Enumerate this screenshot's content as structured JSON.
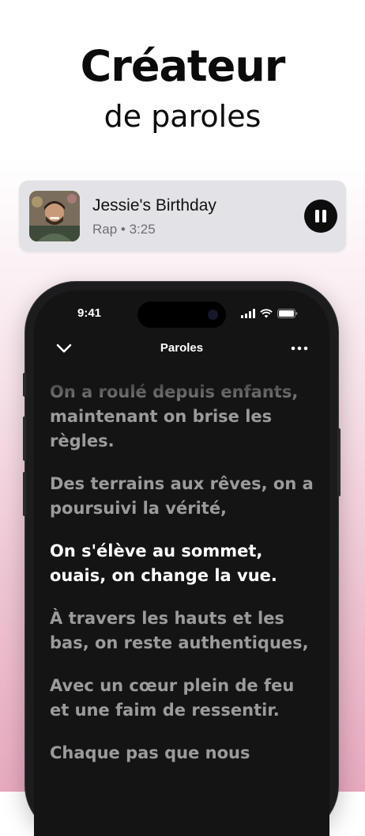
{
  "headline": {
    "title": "Créateur",
    "subtitle": "de paroles"
  },
  "now_playing": {
    "title": "Jessie's Birthday",
    "meta": "Rap • 3:25"
  },
  "phone": {
    "status_time": "9:41",
    "nav_title": "Paroles",
    "lyrics": [
      "On a roulé depuis enfants, maintenant on brise les règles.",
      "Des terrains aux rêves, on a poursuivi la vérité,",
      "On s'élève au sommet, ouais, on change la vue.",
      "À travers les hauts et les bas, on reste authentiques,",
      "Avec un cœur plein de feu et une faim de ressentir.",
      "Chaque pas que nous"
    ],
    "active_lyric_index": 2
  },
  "colors": {
    "accent_dark": "#0d0d0d",
    "screen_bg": "#141414",
    "lyric_inactive": "#9b9b9b",
    "lyric_active": "#ffffff",
    "gradient_pink": "#e7a9bf"
  }
}
